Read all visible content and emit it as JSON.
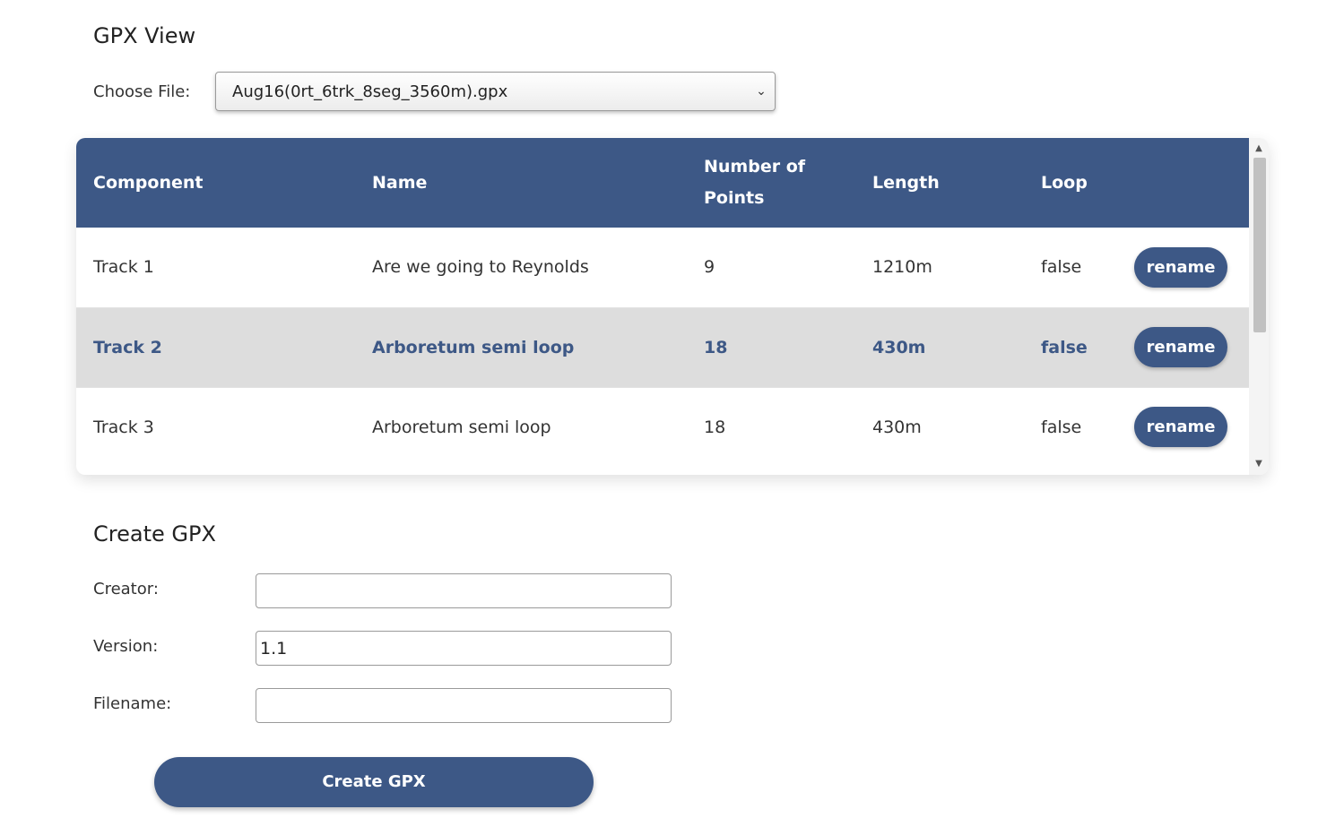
{
  "gpx_view": {
    "title": "GPX View",
    "choose_file_label": "Choose File:",
    "selected_file": "Aug16(0rt_6trk_8seg_3560m).gpx",
    "select_icon": "chevron-down-icon"
  },
  "table": {
    "headers": {
      "component": "Component",
      "name": "Name",
      "points_line1": "Number of",
      "points_line2": "Points",
      "length": "Length",
      "loop": "Loop"
    },
    "rows": [
      {
        "component": "Track 1",
        "name": "Are we going to Reynolds",
        "points": "9",
        "length": "1210m",
        "loop": "false",
        "action": "rename"
      },
      {
        "component": "Track 2",
        "name": "Arboretum semi loop",
        "points": "18",
        "length": "430m",
        "loop": "false",
        "action": "rename"
      },
      {
        "component": "Track 3",
        "name": "Arboretum semi loop",
        "points": "18",
        "length": "430m",
        "loop": "false",
        "action": "rename"
      }
    ],
    "header_color": "#3d5886",
    "highlight_row_color": "#dddddd"
  },
  "create_gpx": {
    "title": "Create GPX",
    "creator_label": "Creator:",
    "creator_value": "",
    "version_label": "Version:",
    "version_value": "1.1",
    "filename_label": "Filename:",
    "filename_value": "",
    "submit_label": "Create GPX"
  },
  "colors": {
    "accent": "#3d5886"
  }
}
